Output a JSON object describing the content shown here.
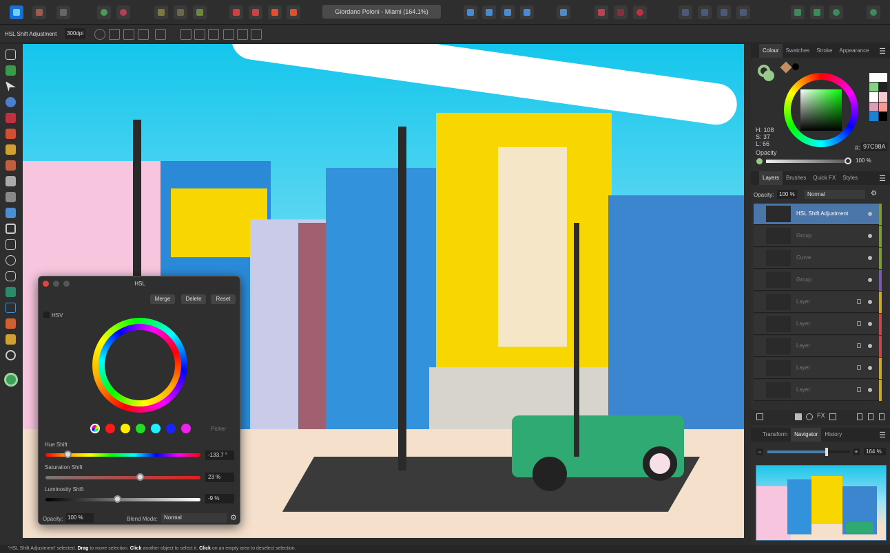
{
  "window": {
    "document_title": "Giordano Poloni - Miami (164.1%)"
  },
  "context_bar": {
    "selection": "HSL Shift Adjustment",
    "dpi": "300dpi"
  },
  "colour_panel": {
    "tabs": [
      "Colour",
      "Swatches",
      "Stroke",
      "Appearance"
    ],
    "active_tab": "Colour",
    "h": "H: 108",
    "s": "S: 37",
    "l": "L: 66",
    "hex_label": "#:",
    "hex": "97C98A",
    "opacity_label": "Opacity",
    "opacity": "100 %",
    "current_color": "#97c98a"
  },
  "layers_panel": {
    "tabs": [
      "Layers",
      "Brushes",
      "Quick FX",
      "Styles"
    ],
    "active_tab": "Layers",
    "opacity_label": "Opacity:",
    "opacity": "100 %",
    "blend": "Normal",
    "layers": [
      {
        "name": "HSL Shift Adjustment",
        "selected": true,
        "tag": "#7a9a3a"
      },
      {
        "name": "Group",
        "tag": "#7a9a3a"
      },
      {
        "name": "Curve",
        "tag": "#7a9a3a"
      },
      {
        "name": "Group",
        "tag": "#7a5aa8"
      },
      {
        "name": "Layer",
        "tag": "#c8a82a",
        "locked": true
      },
      {
        "name": "Layer",
        "tag": "#c04848",
        "locked": true
      },
      {
        "name": "Layer",
        "tag": "#c04848",
        "locked": true
      },
      {
        "name": "Layer",
        "tag": "#c8a82a",
        "locked": true
      },
      {
        "name": "Layer",
        "tag": "#c8a82a",
        "locked": true
      }
    ]
  },
  "navigator_panel": {
    "tabs": [
      "Transform",
      "Navigator",
      "History"
    ],
    "active_tab": "Navigator",
    "zoom": "164 %",
    "zoom_level": 0.72
  },
  "hsl_dialog": {
    "title": "HSL",
    "merge": "Merge",
    "delete": "Delete",
    "reset": "Reset",
    "hsv_label": "HSV",
    "picker": "Picker",
    "swatches": [
      "#ff1a1a",
      "#ffee00",
      "#22dd22",
      "#22eeff",
      "#1a22ff",
      "#ee22ee"
    ],
    "hue_label": "Hue Shift",
    "hue_value": "-133.7 °",
    "hue_pos": 0.14,
    "sat_label": "Saturation Shift",
    "sat_value": "23 %",
    "sat_pos": 0.61,
    "lum_label": "Luminosity Shift",
    "lum_value": "-9 %",
    "lum_pos": 0.46,
    "opacity_label": "Opacity:",
    "opacity": "100 %",
    "blend_label": "Blend Mode:",
    "blend": "Normal"
  },
  "status": {
    "quoted": "'HSL Shift Adjustment' selected. ",
    "w1": "Drag",
    "t1": " to move selection. ",
    "w2": "Click",
    "t2": " another object to select it. ",
    "w3": "Click",
    "t3": " on an empty area to deselect selection."
  }
}
